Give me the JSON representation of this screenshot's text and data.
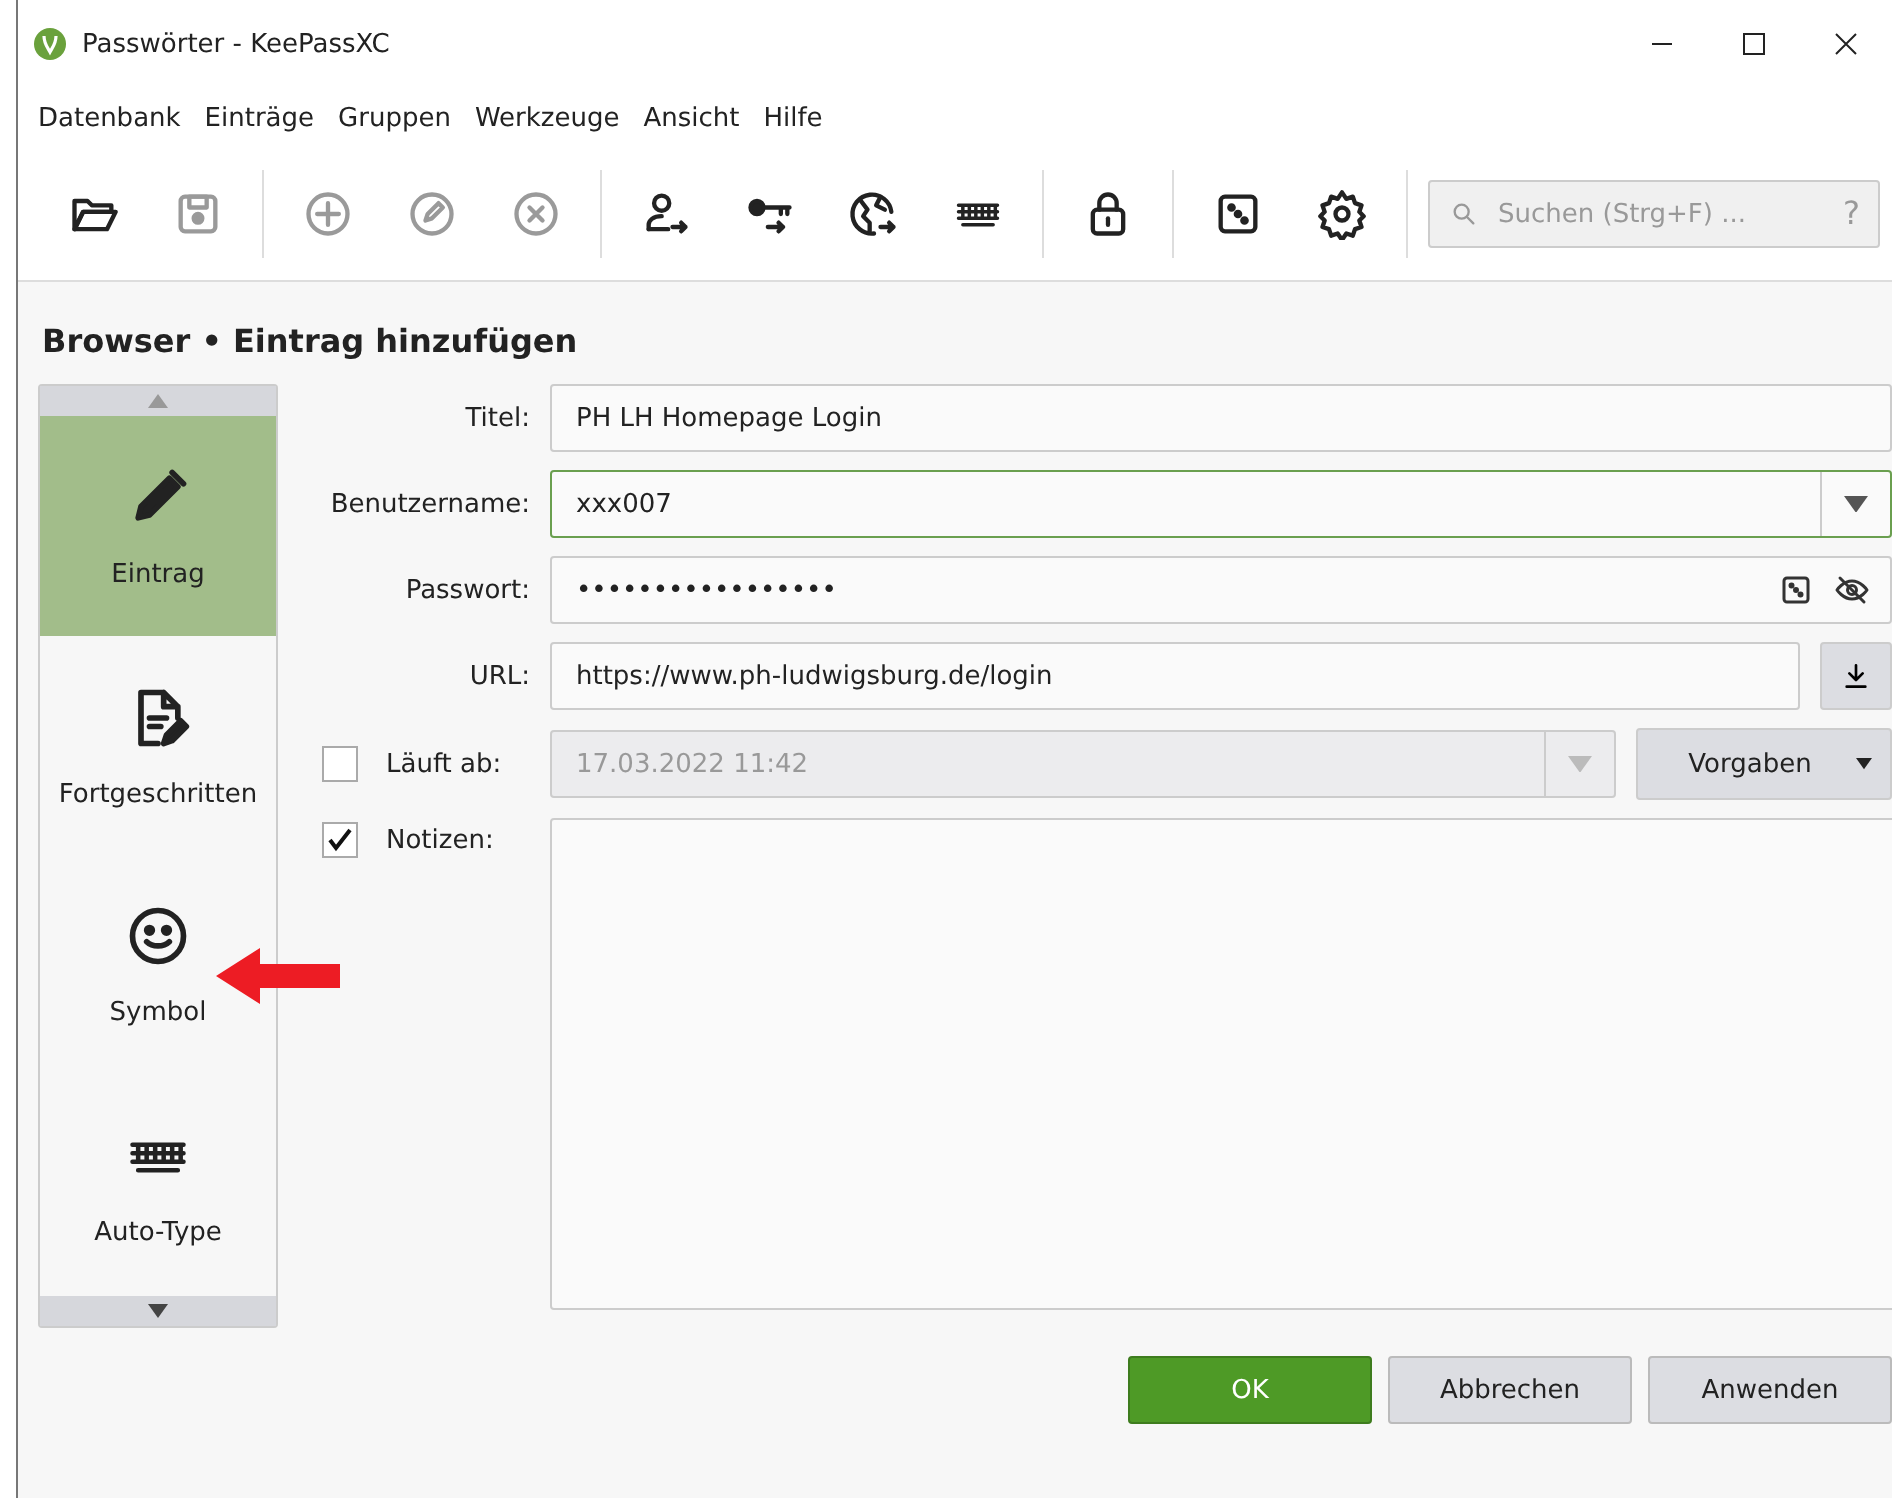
{
  "window": {
    "title": "Passwörter - KeePassXC"
  },
  "menu": [
    "Datenbank",
    "Einträge",
    "Gruppen",
    "Werkzeuge",
    "Ansicht",
    "Hilfe"
  ],
  "toolbar": [
    [
      {
        "disabled": false
      },
      {
        "disabled": true
      }
    ],
    [
      {
        "disabled": true
      },
      {
        "disabled": true
      },
      {
        "disabled": true
      }
    ],
    [
      {
        "disabled": false
      },
      {
        "disabled": false
      },
      {
        "disabled": false
      },
      {
        "disabled": false
      }
    ],
    [
      {
        "disabled": false
      }
    ],
    [
      {
        "disabled": false
      },
      {
        "disabled": false
      }
    ]
  ],
  "search": {
    "placeholder": "Suchen (Strg+F) ...",
    "help": "?"
  },
  "page_title": "Browser • Eintrag hinzufügen",
  "categories": [
    {
      "label": "Eintrag",
      "selected": true
    },
    {
      "label": "Fortgeschritten",
      "selected": false
    },
    {
      "label": "Symbol",
      "selected": false
    },
    {
      "label": "Auto-Type",
      "selected": false
    }
  ],
  "form": {
    "title": {
      "label": "Titel:",
      "value": "PH LH Homepage Login"
    },
    "username": {
      "label": "Benutzername:",
      "value": "xxx007"
    },
    "password": {
      "label": "Passwort:",
      "value": "•••••••••••••••••"
    },
    "url": {
      "label": "URL:",
      "value": "https://www.ph-ludwigsburg.de/login"
    },
    "expires": {
      "label": "Läuft ab:",
      "checked": false,
      "value": "17.03.2022 11:42",
      "presets": "Vorgaben"
    },
    "notes": {
      "label": "Notizen:",
      "checked": true
    }
  },
  "buttons": [
    {
      "label": "OK",
      "kind": "primary"
    },
    {
      "label": "Abbrechen",
      "kind": "normal"
    },
    {
      "label": "Anwenden",
      "kind": "normal"
    }
  ]
}
